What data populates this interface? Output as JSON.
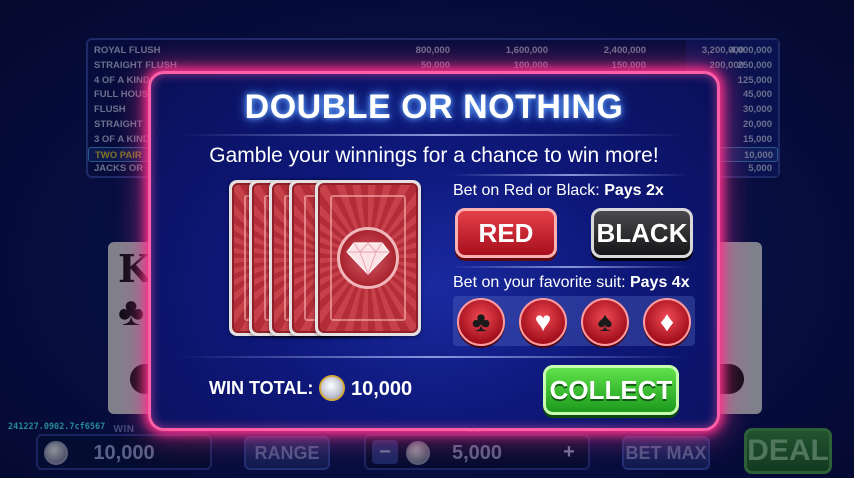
{
  "paytable": {
    "rows": [
      {
        "hand": "ROYAL FLUSH",
        "pays": [
          "800,000",
          "1,600,000",
          "2,400,000",
          "3,200,000",
          "4,000,000"
        ]
      },
      {
        "hand": "STRAIGHT FLUSH",
        "pays": [
          "50,000",
          "100,000",
          "150,000",
          "200,000",
          "250,000"
        ]
      },
      {
        "hand": "4 OF A KIND",
        "pays": [
          "",
          "",
          "",
          "",
          "125,000"
        ]
      },
      {
        "hand": "FULL HOUS",
        "pays": [
          "",
          "",
          "",
          "",
          "45,000"
        ]
      },
      {
        "hand": "FLUSH",
        "pays": [
          "",
          "",
          "",
          "",
          "30,000"
        ]
      },
      {
        "hand": "STRAIGHT",
        "pays": [
          "",
          "",
          "",
          "",
          "20,000"
        ]
      },
      {
        "hand": "3 OF A KIND",
        "pays": [
          "",
          "",
          "",
          "",
          "15,000"
        ]
      },
      {
        "hand": "TWO PAIR",
        "pays": [
          "",
          "",
          "",
          "",
          "10,000"
        ],
        "highlighted": true
      },
      {
        "hand": "JACKS OR",
        "pays": [
          "",
          "",
          "",
          "",
          "5,000"
        ]
      }
    ]
  },
  "background_cards": {
    "left": {
      "rank": "K",
      "suit": "♣"
    }
  },
  "bottom_bar": {
    "build_id": "241227.0902.7cf6567",
    "win_label": "WIN",
    "win_value": "10,000",
    "range_label": "RANGE",
    "bet_label": "BET",
    "bet_value": "5,000",
    "bet_minus": "−",
    "bet_plus": "+",
    "bet_max_label": "BET MAX",
    "deal_label": "DEAL"
  },
  "modal": {
    "title": "DOUBLE OR NOTHING",
    "subtitle": "Gamble your winnings for a chance to win more!",
    "color_bet": {
      "label": "Bet on Red or Black: ",
      "pays": "Pays 2x",
      "red_label": "RED",
      "black_label": "BLACK"
    },
    "suit_bet": {
      "label": "Bet on your favorite suit: ",
      "pays": "Pays 4x",
      "suits": [
        {
          "symbol": "♣",
          "name": "clubs",
          "tone": "dark"
        },
        {
          "symbol": "♥",
          "name": "hearts",
          "tone": "light"
        },
        {
          "symbol": "♠",
          "name": "spades",
          "tone": "dark"
        },
        {
          "symbol": "♦",
          "name": "diamonds",
          "tone": "light"
        }
      ]
    },
    "win_total_label": "WIN TOTAL:",
    "win_total_value": "10,000",
    "collect_label": "COLLECT"
  },
  "colors": {
    "modal_border": "#ff5fa8",
    "red_button": "#c41f2b",
    "black_button": "#2a2a2e",
    "collect_button": "#3cc234",
    "highlight_row": "#f3d42b"
  }
}
